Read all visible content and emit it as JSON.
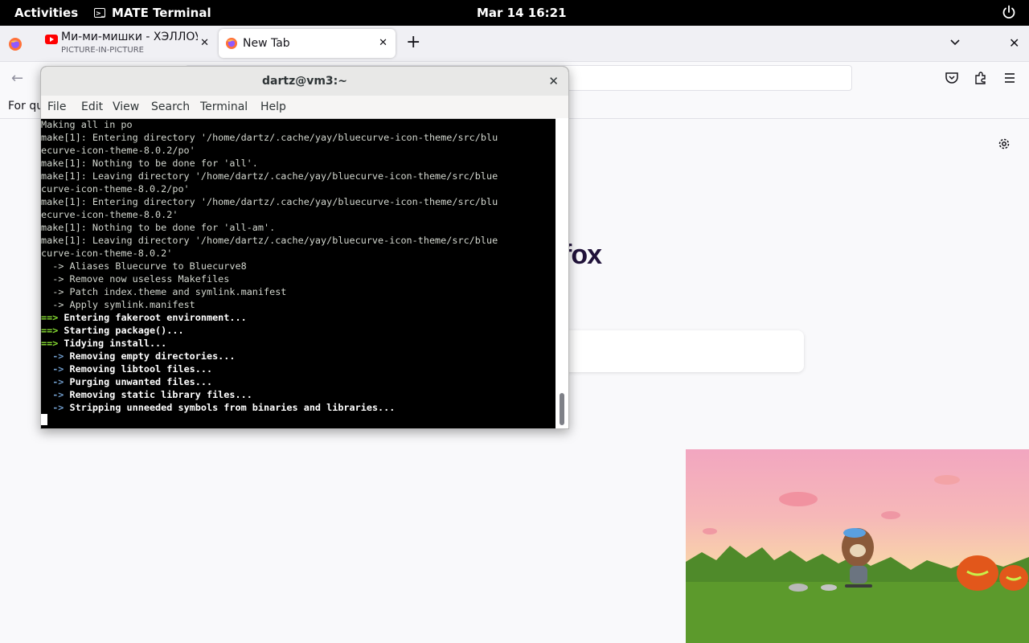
{
  "topbar": {
    "activities": "Activities",
    "app_name": "MATE Terminal",
    "clock": "Mar 14  16:21",
    "power_icon": "power-icon"
  },
  "firefox": {
    "tabs": [
      {
        "title": "Ми-ми-мишки - ХЭЛЛОУИН",
        "subtitle": "PICTURE-IN-PICTURE",
        "icon": "youtube-icon"
      },
      {
        "title": "New Tab",
        "icon": "firefox-icon",
        "active": true
      }
    ],
    "bookmarks_label": "For qu",
    "brand_fragment": "fox"
  },
  "terminal": {
    "title": "dartz@vm3:~",
    "menu": [
      "File",
      "Edit",
      "View",
      "Search",
      "Terminal",
      "Help"
    ],
    "lines": [
      {
        "p": "",
        "t": "Making all in po",
        "s": "n"
      },
      {
        "p": "",
        "t": "make[1]: Entering directory '/home/dartz/.cache/yay/bluecurve-icon-theme/src/blu",
        "s": "n"
      },
      {
        "p": "",
        "t": "ecurve-icon-theme-8.0.2/po'",
        "s": "n"
      },
      {
        "p": "",
        "t": "make[1]: Nothing to be done for 'all'.",
        "s": "n"
      },
      {
        "p": "",
        "t": "make[1]: Leaving directory '/home/dartz/.cache/yay/bluecurve-icon-theme/src/blue",
        "s": "n"
      },
      {
        "p": "",
        "t": "curve-icon-theme-8.0.2/po'",
        "s": "n"
      },
      {
        "p": "",
        "t": "make[1]: Entering directory '/home/dartz/.cache/yay/bluecurve-icon-theme/src/blu",
        "s": "n"
      },
      {
        "p": "",
        "t": "ecurve-icon-theme-8.0.2'",
        "s": "n"
      },
      {
        "p": "",
        "t": "make[1]: Nothing to be done for 'all-am'.",
        "s": "n"
      },
      {
        "p": "",
        "t": "make[1]: Leaving directory '/home/dartz/.cache/yay/bluecurve-icon-theme/src/blue",
        "s": "n"
      },
      {
        "p": "",
        "t": "curve-icon-theme-8.0.2'",
        "s": "n"
      },
      {
        "p": "  ",
        "t": "-> Aliases Bluecurve to Bluecurve8",
        "s": "n"
      },
      {
        "p": "  ",
        "t": "-> Remove now useless Makefiles",
        "s": "n"
      },
      {
        "p": "  ",
        "t": "-> Patch index.theme and symlink.manifest",
        "s": "n"
      },
      {
        "p": "  ",
        "t": "-> Apply symlink.manifest",
        "s": "n"
      },
      {
        "p": "==>",
        "t": " Entering fakeroot environment...",
        "s": "g"
      },
      {
        "p": "==>",
        "t": " Starting package()...",
        "s": "g"
      },
      {
        "p": "==>",
        "t": " Tidying install...",
        "s": "g"
      },
      {
        "p": "  ->",
        "t": " Removing empty directories...",
        "s": "b"
      },
      {
        "p": "  ->",
        "t": " Removing libtool files...",
        "s": "b"
      },
      {
        "p": "  ->",
        "t": " Purging unwanted files...",
        "s": "b"
      },
      {
        "p": "  ->",
        "t": " Removing static library files...",
        "s": "b"
      },
      {
        "p": "  ->",
        "t": " Stripping unneeded symbols from binaries and libraries...",
        "s": "b"
      }
    ]
  },
  "colors": {
    "terminal_bg": "#000000",
    "prompt_green": "#8ae234",
    "arrow_blue": "#729fcf"
  }
}
